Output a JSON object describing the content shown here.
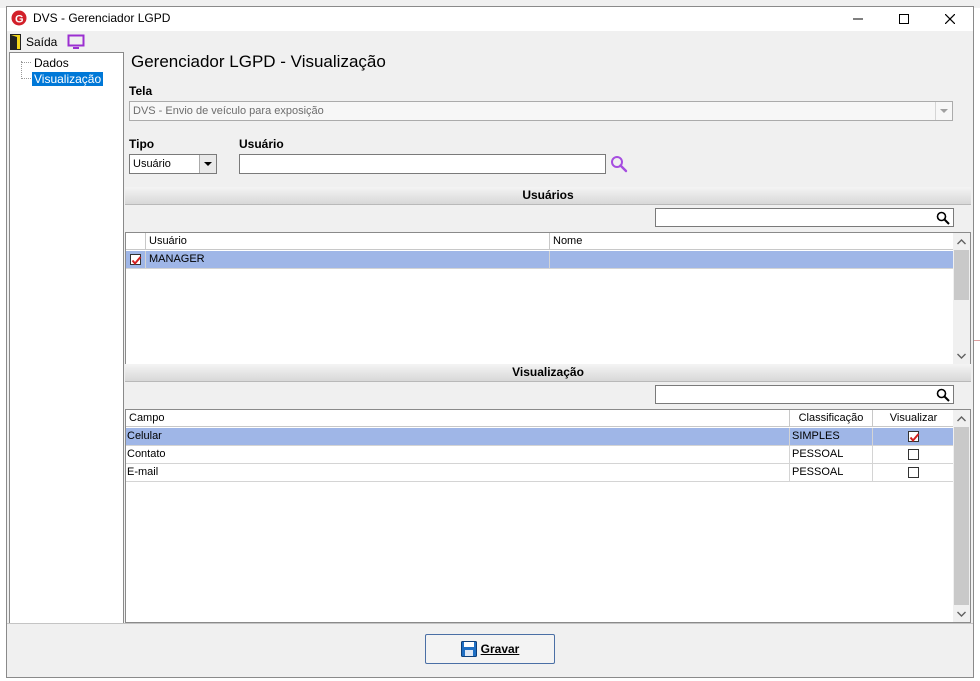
{
  "window": {
    "title": "DVS - Gerenciador LGPD"
  },
  "toolbar": {
    "exit_label": "Saída"
  },
  "tree": {
    "items": [
      "Dados",
      "Visualização"
    ]
  },
  "form": {
    "title": "Gerenciador LGPD - Visualização",
    "tela_label": "Tela",
    "tela_value": "DVS - Envio de veículo para exposição",
    "tipo_label": "Tipo",
    "tipo_value": "Usuário",
    "usuario_label": "Usuário",
    "usuario_value": ""
  },
  "users_section": {
    "header": "Usuários",
    "search_value": "",
    "columns": [
      "Usuário",
      "Nome"
    ],
    "rows": [
      {
        "checked": true,
        "usuario": "MANAGER",
        "nome": ""
      }
    ]
  },
  "view_section": {
    "header": "Visualização",
    "search_value": "",
    "columns": [
      "Campo",
      "Classificação",
      "Visualizar"
    ],
    "rows": [
      {
        "campo": "Celular",
        "classificacao": "SIMPLES",
        "visualizar": true
      },
      {
        "campo": "Contato",
        "classificacao": "PESSOAL",
        "visualizar": false
      },
      {
        "campo": "E-mail",
        "classificacao": "PESSOAL",
        "visualizar": false
      }
    ]
  },
  "footer": {
    "save_label": "Gravar"
  },
  "colors": {
    "selection": "#9fb6e7",
    "tree_selection": "#0078d7",
    "check_red": "#d42020",
    "accent_purple": "#9b2fd1"
  }
}
